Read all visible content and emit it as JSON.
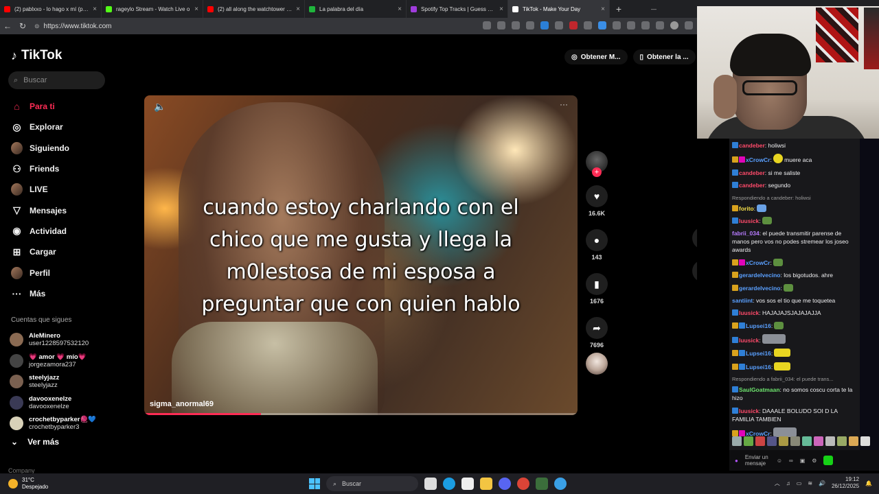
{
  "browser": {
    "tabs": [
      {
        "title": "(2) pablxxo - lo hago x mí (prod. A",
        "fav_color": "#ff0000"
      },
      {
        "title": "rageylo Stream - Watch Live o",
        "fav_color": "#53fc18"
      },
      {
        "title": "(2) all along the watchtower - You",
        "fav_color": "#ff0000"
      },
      {
        "title": "La palabra del día",
        "fav_color": "#1fb53c"
      },
      {
        "title": "Spotify Top Tracks | Guess which s",
        "fav_color": "#a03cdc"
      },
      {
        "title": "TikTok - Make Your Day",
        "fav_color": "#ffffff",
        "active": true
      }
    ],
    "url": "https://www.tiktok.com"
  },
  "tiktok": {
    "logo": "TikTok",
    "search_placeholder": "Buscar",
    "menu": [
      {
        "label": "Para ti",
        "icon": "home-icon",
        "glyph": "⌂",
        "active": true
      },
      {
        "label": "Explorar",
        "icon": "compass-icon",
        "glyph": "◎"
      },
      {
        "label": "Siguiendo",
        "icon": "following-avatar-icon",
        "glyph": ""
      },
      {
        "label": "Friends",
        "icon": "friends-icon",
        "glyph": "⚇"
      },
      {
        "label": "LIVE",
        "icon": "live-avatar-icon",
        "glyph": ""
      },
      {
        "label": "Mensajes",
        "icon": "send-icon",
        "glyph": "▽"
      },
      {
        "label": "Actividad",
        "icon": "activity-icon",
        "glyph": "◉"
      },
      {
        "label": "Cargar",
        "icon": "upload-icon",
        "glyph": "⊞"
      },
      {
        "label": "Perfil",
        "icon": "profile-avatar-icon",
        "glyph": ""
      },
      {
        "label": "Más",
        "icon": "more-icon",
        "glyph": "···"
      }
    ],
    "follows_title": "Cuentas que sigues",
    "follows": [
      {
        "name": "AleMinero",
        "handle": "user1228597532120",
        "color": "#8a6a52"
      },
      {
        "name": "💗 amor 💗 mío💗",
        "handle": "jorgezamora237",
        "color": "#444"
      },
      {
        "name": "steelyjazz",
        "handle": "steelyjazz",
        "color": "#7a6050"
      },
      {
        "name": "davooxenelze",
        "handle": "davooxenelze",
        "color": "#3a3a55"
      },
      {
        "name": "crochetbyparker🧶💙",
        "handle": "crochetbyparker3",
        "color": "#d8d1b8"
      }
    ],
    "ver_mas": "Ver más",
    "company": "Company",
    "top_buttons": [
      "Obtener M...",
      "Obtener la ..."
    ],
    "video": {
      "caption_lines": [
        "cuando estoy charlando con el",
        "chico que me gusta y llega la",
        "m0lestosa de mi esposa a",
        "preguntar que con quien hablo"
      ],
      "author": "sigma_anormal69",
      "progress": 0.27
    },
    "actions": {
      "likes": "16.6K",
      "comments": "143",
      "saves": "1676",
      "shares": "7696"
    }
  },
  "chat": {
    "messages": [
      {
        "badges": [
          "prime"
        ],
        "user": "candeber",
        "color": "#ff4a6a",
        "text": ": holiwsi"
      },
      {
        "badges": [
          "sub",
          "vip"
        ],
        "user": "xCrowCr",
        "color": "#5aa0ff",
        "text": ":",
        "emote": "yellow-round",
        "after": " muere aca"
      },
      {
        "badges": [
          "prime"
        ],
        "user": "candeber",
        "color": "#ff4a6a",
        "text": ": si me saliste"
      },
      {
        "badges": [
          "prime"
        ],
        "user": "candeber",
        "color": "#ff4a6a",
        "text": ": segundo"
      },
      {
        "reply": "Respondiendo a candeber: holiwsi",
        "badges": [
          "sub"
        ],
        "user": "forito",
        "color": "#f6e04a",
        "text": ":",
        "emote": "blue"
      },
      {
        "badges": [
          "prime"
        ],
        "user": "luusick",
        "color": "#ff4a6a",
        "text": ":",
        "emote": "green"
      },
      {
        "badges": [],
        "user": "fabrii_034",
        "color": "#b77bff",
        "text": ": el puede transmitir parense de manos pero vos no podes stremear los joseo awards"
      },
      {
        "badges": [
          "sub",
          "vip"
        ],
        "user": "xCrowCr",
        "color": "#5aa0ff",
        "text": ":",
        "emote": "green"
      },
      {
        "badges": [
          "sub"
        ],
        "user": "gerardelvecino",
        "color": "#5aa0ff",
        "text": ": los bigotudos. ahre"
      },
      {
        "badges": [
          "sub"
        ],
        "user": "gerardelvecino",
        "color": "#5aa0ff",
        "text": ":",
        "emote": "green"
      },
      {
        "badges": [],
        "user": "santiint",
        "color": "#5aa0ff",
        "text": ": vos sos el tio que me toquetea"
      },
      {
        "badges": [
          "prime"
        ],
        "user": "luusick",
        "color": "#ff4a6a",
        "text": ": HAJAJAJSJAJAJAJJA"
      },
      {
        "badges": [
          "sub",
          "prime"
        ],
        "user": "Lupsei16",
        "color": "#5aa0ff",
        "text": ":",
        "emote": "green"
      },
      {
        "badges": [
          "prime"
        ],
        "user": "luusick",
        "color": "#ff4a6a",
        "text": ":",
        "emote": "gray"
      },
      {
        "badges": [
          "sub",
          "prime"
        ],
        "user": "Lupsei16",
        "color": "#5aa0ff",
        "text": ":",
        "emote": "yellow"
      },
      {
        "badges": [
          "sub",
          "prime"
        ],
        "user": "Lupsei16",
        "color": "#5aa0ff",
        "text": ":",
        "emote": "yellow"
      },
      {
        "reply": "Respondiendo a fabrii_034: el puede trans...",
        "badges": [
          "prime"
        ],
        "user": "SaulGoatmaan",
        "color": "#6ee46e",
        "text": ": no somos coscu corta te la hizo"
      },
      {
        "badges": [
          "prime"
        ],
        "user": "luusick",
        "color": "#ff4a6a",
        "text": ": DAAALE BOLUDO SOI D LA FAMILIA TAMBIEN"
      },
      {
        "badges": [
          "sub",
          "vip"
        ],
        "user": "xCrowCr",
        "color": "#5aa0ff",
        "text": ":",
        "emote": "gray"
      }
    ],
    "input_placeholder": "Enviar un mensaje"
  },
  "taskbar": {
    "temp": "31°C",
    "weather": "Despejado",
    "search": "Buscar",
    "time": "19:12",
    "date": "26/12/2025"
  }
}
